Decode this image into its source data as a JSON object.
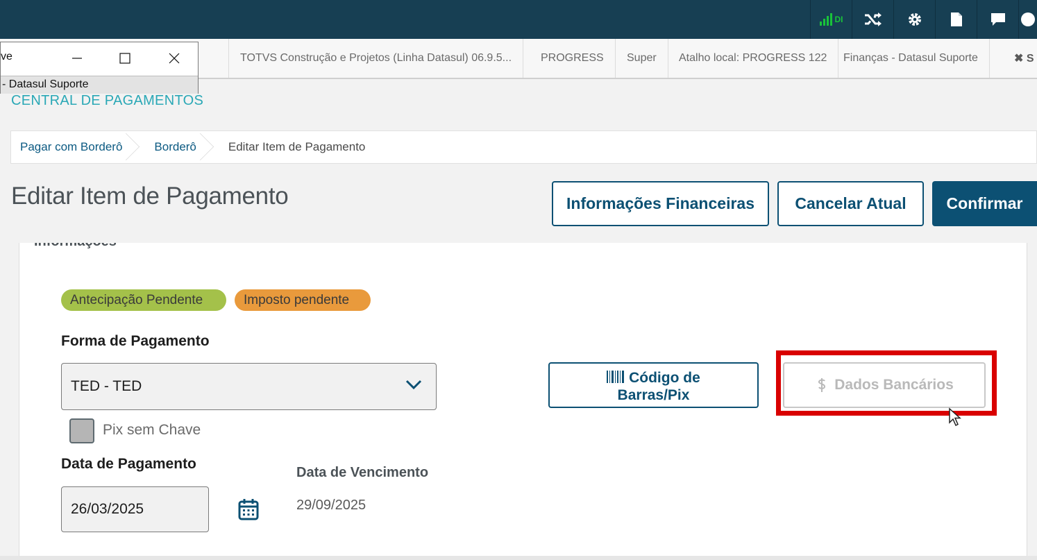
{
  "topbar": {
    "signal_text": "DI",
    "icons": [
      "signal-icon",
      "shuffle-icon",
      "gear-icon",
      "document-icon",
      "chat-icon",
      "help-icon"
    ],
    "colors": {
      "background": "#173f53",
      "signal": "#19c33a"
    }
  },
  "mini_window": {
    "title": "ve",
    "subtitle": "- Datasul Suporte"
  },
  "tabs": [
    {
      "label": "TOTVS Construção e Projetos (Linha Datasul) 06.9.5..."
    },
    {
      "label": "PROGRESS"
    },
    {
      "label": "Super"
    },
    {
      "label": "Atalho local: PROGRESS 122"
    },
    {
      "label": "Finanças - Datasul Suporte"
    },
    {
      "label": "✖ S"
    }
  ],
  "module_title": "CENTRAL DE PAGAMENTOS",
  "breadcrumb": [
    {
      "label": "Pagar com Borderô"
    },
    {
      "label": "Borderô"
    },
    {
      "label": "Editar Item de Pagamento"
    }
  ],
  "page": {
    "title": "Editar Item de Pagamento",
    "actions": {
      "financial_info": "Informações Financeiras",
      "cancel": "Cancelar Atual",
      "confirm": "Confirmar"
    }
  },
  "panel": {
    "title": "Informações",
    "badges": {
      "anticipation": "Antecipação Pendente",
      "tax": "Imposto pendente"
    },
    "payment_method": {
      "label": "Forma de Pagamento",
      "value": "TED - TED"
    },
    "pix_no_key": {
      "label": "Pix sem Chave",
      "checked": false
    },
    "payment_date": {
      "label": "Data de Pagamento",
      "value": "26/03/2025"
    },
    "due_date": {
      "label": "Data de Vencimento",
      "value": "29/09/2025"
    },
    "barcode_button": {
      "line1": "Código de",
      "line2": "Barras/Pix"
    },
    "bank_button": {
      "label": "Dados Bancários",
      "disabled": true
    }
  },
  "colors": {
    "accent": "#0c5073",
    "module_title": "#2aa8b6",
    "badge_green": "#a4c14a",
    "badge_orange": "#e99a3c",
    "highlight": "#d90000"
  }
}
